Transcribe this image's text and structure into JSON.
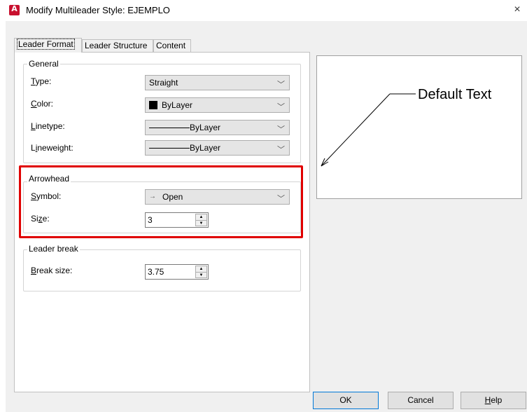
{
  "window": {
    "title": "Modify Multileader Style: EJEMPLO",
    "close_glyph": "×"
  },
  "tabs": [
    {
      "label": "Leader Format",
      "active": true
    },
    {
      "label": "Leader Structure",
      "active": false
    },
    {
      "label": "Content",
      "active": false
    }
  ],
  "general": {
    "legend": "General",
    "type_label_u": "T",
    "type_label_rest": "ype:",
    "type_value": "Straight",
    "color_label_u": "C",
    "color_label_rest": "olor:",
    "color_value": "ByLayer",
    "color_swatch": "#000000",
    "linetype_label_u": "L",
    "linetype_label_rest": "inetype:",
    "linetype_value": "ByLayer",
    "lineweight_label_pre": "L",
    "lineweight_label_u": "i",
    "lineweight_label_rest": "neweight:",
    "lineweight_value": "ByLayer"
  },
  "arrowhead": {
    "legend": "Arrowhead",
    "symbol_label_u": "S",
    "symbol_label_rest": "ymbol:",
    "symbol_glyph": "→",
    "symbol_value": "Open",
    "size_label_pre": "Si",
    "size_label_u": "z",
    "size_label_rest": "e:",
    "size_value": "3"
  },
  "leader_break": {
    "legend": "Leader break",
    "break_label_u": "B",
    "break_label_rest": "reak size:",
    "break_value": "3.75"
  },
  "preview": {
    "text": "Default Text"
  },
  "buttons": {
    "ok": "OK",
    "cancel": "Cancel",
    "help_u": "H",
    "help_rest": "elp"
  },
  "colors": {
    "highlight": "#e00000",
    "ok_border": "#0078d7"
  }
}
